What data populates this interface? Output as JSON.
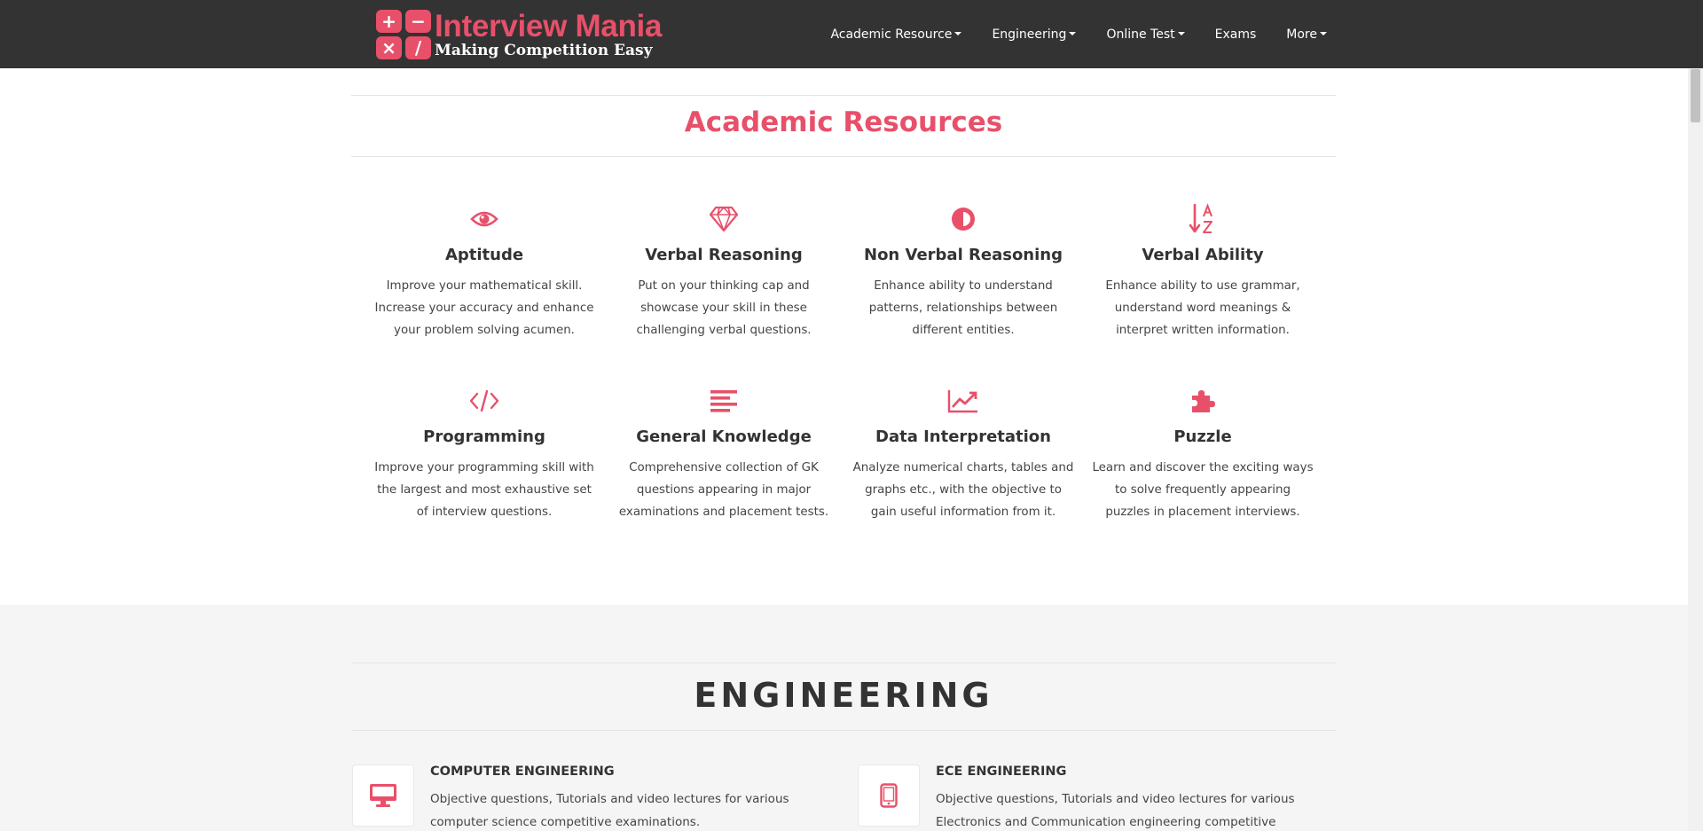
{
  "brand": {
    "name": "Interview Mania",
    "tagline": "Making Competition Easy",
    "logo_symbols": [
      "+",
      "−",
      "×",
      "/"
    ]
  },
  "nav": {
    "items": [
      {
        "label": "Academic Resource",
        "dropdown": true
      },
      {
        "label": "Engineering",
        "dropdown": true
      },
      {
        "label": "Online Test",
        "dropdown": true
      },
      {
        "label": "Exams",
        "dropdown": false
      },
      {
        "label": "More",
        "dropdown": true
      }
    ]
  },
  "academic": {
    "title": "Academic Resources",
    "cards": [
      {
        "icon": "eye-icon",
        "title": "Aptitude",
        "desc": "Improve your mathematical skill. Increase your accuracy and enhance your problem solving acumen."
      },
      {
        "icon": "diamond-icon",
        "title": "Verbal Reasoning",
        "desc": "Put on your thinking cap and showcase your skill in these challenging verbal questions."
      },
      {
        "icon": "adjust-icon",
        "title": "Non Verbal Reasoning",
        "desc": "Enhance ability to understand patterns, relationships between different entities."
      },
      {
        "icon": "sort-alpha-icon",
        "title": "Verbal Ability",
        "desc": "Enhance ability to use grammar, understand word meanings & interpret written information."
      },
      {
        "icon": "code-icon",
        "title": "Programming",
        "desc": "Improve your programming skill with the largest and most exhaustive set of interview questions."
      },
      {
        "icon": "align-left-icon",
        "title": "General Knowledge",
        "desc": "Comprehensive collection of GK questions appearing in major examinations and placement tests."
      },
      {
        "icon": "line-chart-icon",
        "title": "Data Interpretation",
        "desc": "Analyze numerical charts, tables and graphs etc., with the objective to gain useful information from it."
      },
      {
        "icon": "puzzle-icon",
        "title": "Puzzle",
        "desc": "Learn and discover the exciting ways to solve frequently appearing puzzles in placement interviews."
      }
    ]
  },
  "engineering": {
    "title": "ENGINEERING",
    "cards": [
      {
        "icon": "desktop-icon",
        "title": "COMPUTER ENGINEERING",
        "desc": "Objective questions, Tutorials and video lectures for various computer science competitive examinations."
      },
      {
        "icon": "tablet-icon",
        "title": "ECE ENGINEERING",
        "desc": "Objective questions, Tutorials and video lectures for various Electronics and Communication engineering competitive"
      }
    ]
  },
  "colors": {
    "accent": "#e8506a",
    "navbar": "#333333",
    "engineering_bg": "#f5f5f5"
  }
}
